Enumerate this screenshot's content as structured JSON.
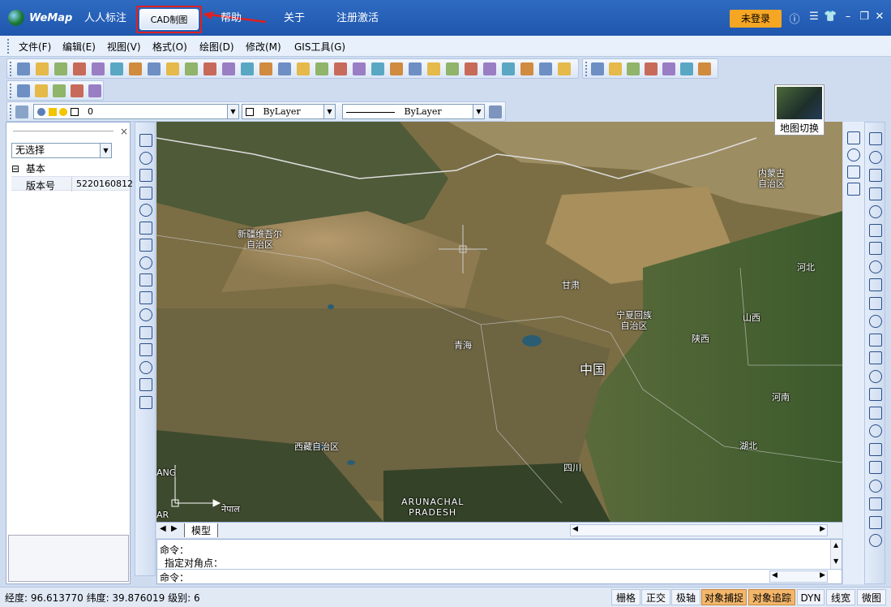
{
  "app": {
    "name": "WeMap"
  },
  "nav": {
    "tabs": [
      "人人标注",
      "CAD制图",
      "帮助",
      "关于",
      "注册激活"
    ],
    "active": "CAD制图"
  },
  "login": "未登录",
  "menu": [
    "文件(F)",
    "编辑(E)",
    "视图(V)",
    "格式(O)",
    "绘图(D)",
    "修改(M)",
    "GIS工具(G)"
  ],
  "layer_toolbar": {
    "layer_value": "0",
    "color_value": "ByLayer",
    "linetype_value": "ByLayer"
  },
  "left_panel": {
    "selection": "无选择",
    "group": "基本",
    "property_label": "版本号",
    "property_value": "5220160812"
  },
  "map": {
    "switch_label": "地图切换",
    "labels": [
      "新疆维吾尔",
      "自治区",
      "内蒙古",
      "自治区",
      "甘肃",
      "宁夏回族",
      "自治区",
      "山西",
      "河北",
      "陕西",
      "青海",
      "中国",
      "河南",
      "西藏自治区",
      "湖北",
      "四川",
      "ARUNACHAL",
      "PRADESH",
      "ANG",
      "AR",
      "नेपाल"
    ]
  },
  "bottom_tab": "模型",
  "command": {
    "line1": "命令：",
    "line2": "指定对角点：",
    "line3": "命令："
  },
  "status": {
    "coords": "经度: 96.613770 纬度: 39.876019 级别: 6",
    "toggles": [
      "栅格",
      "正交",
      "极轴",
      "对象捕捉",
      "对象追踪",
      "DYN",
      "线宽",
      "微图"
    ]
  },
  "colors": {
    "titlebar": "#2f6bc2",
    "login": "#f5a623",
    "highlight": "#e02020",
    "toggle_on": "#f3b66a"
  }
}
